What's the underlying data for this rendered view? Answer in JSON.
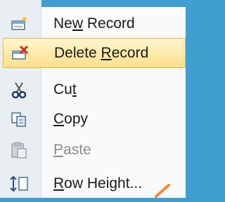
{
  "menu": {
    "items": [
      {
        "before": "Ne",
        "accel": "w",
        "after": " Record",
        "icon": "new-record-icon",
        "state": "normal"
      },
      {
        "before": "Delete ",
        "accel": "R",
        "after": "ecord",
        "icon": "delete-record-icon",
        "state": "highlighted"
      },
      {
        "before": "Cu",
        "accel": "t",
        "after": "",
        "icon": "scissors-icon",
        "state": "normal"
      },
      {
        "before": "",
        "accel": "C",
        "after": "opy",
        "icon": "copy-icon",
        "state": "normal"
      },
      {
        "before": "",
        "accel": "P",
        "after": "aste",
        "icon": "paste-icon",
        "state": "disabled"
      },
      {
        "before": "",
        "accel": "R",
        "after": "ow Height...",
        "icon": "row-height-icon",
        "state": "normal"
      }
    ]
  },
  "colors": {
    "highlight_top": "#fff6cf",
    "highlight_bottom": "#ffdf8a",
    "gutter": "#e9eef3",
    "cursor": "#f08a3c",
    "backdrop": "#3f9fd1"
  }
}
